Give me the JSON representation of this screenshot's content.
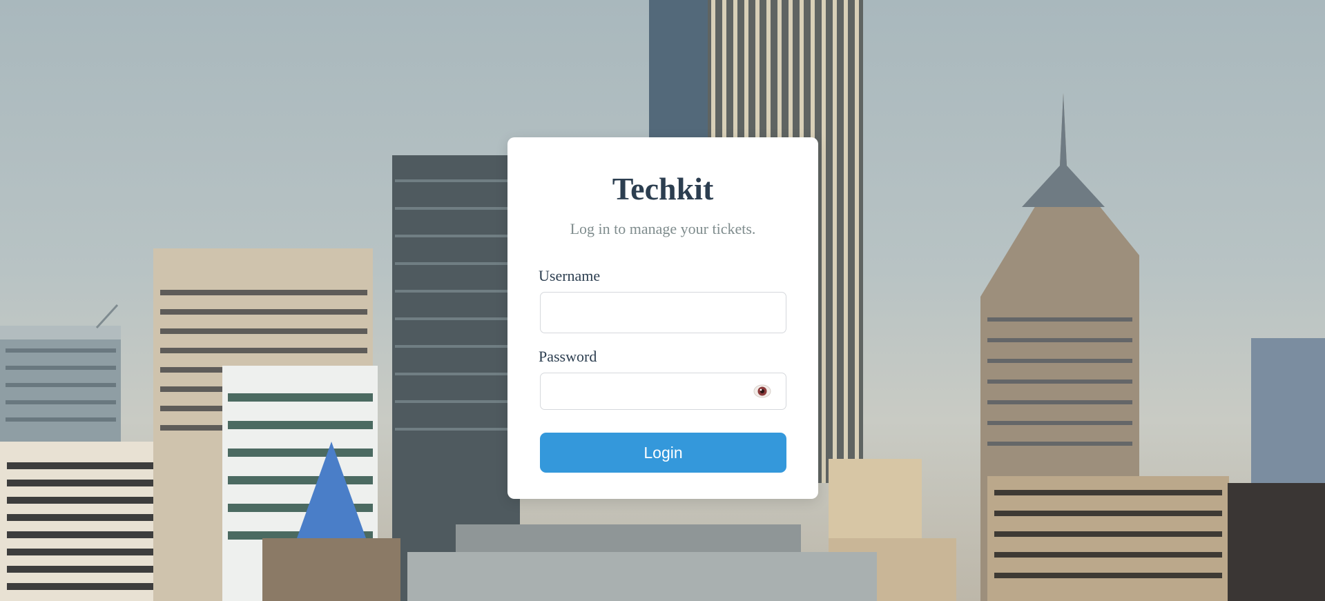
{
  "app": {
    "title": "Techkit",
    "subtitle": "Log in to manage your tickets."
  },
  "form": {
    "username_label": "Username",
    "username_value": "",
    "password_label": "Password",
    "password_value": "",
    "login_label": "Login"
  },
  "icons": {
    "password_toggle": "eye-icon"
  },
  "colors": {
    "title": "#2c3e50",
    "subtitle": "#7f8c8d",
    "button": "#3498db",
    "button_text": "#ffffff",
    "card": "#ffffff"
  }
}
